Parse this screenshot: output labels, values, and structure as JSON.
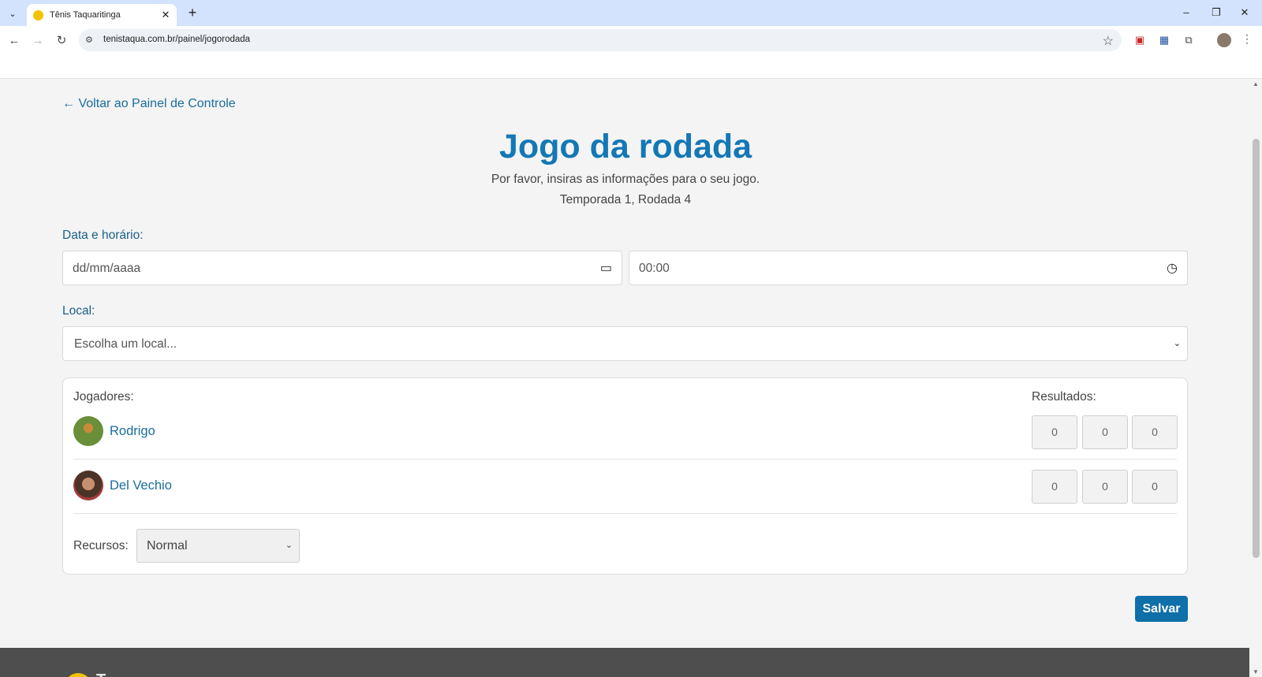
{
  "browser": {
    "tab_title": "Tênis Taquaritinga",
    "url": "tenistaqua.com.br/painel/jogorodada"
  },
  "page": {
    "back_link": "← Voltar ao Painel de Controle",
    "title": "Jogo da rodada",
    "subtitle": "Por favor, insiras as informações para o seu jogo.",
    "round": "Temporada 1, Rodada 4"
  },
  "form": {
    "datetime_label": "Data e horário:",
    "date_placeholder": "dd/mm/aaaa",
    "time_value": "00:00",
    "local_label": "Local:",
    "local_placeholder": "Escolha um local...",
    "players_label": "Jogadores:",
    "results_label": "Resultados:",
    "players": [
      {
        "name": "Rodrigo",
        "scores": [
          "0",
          "0",
          "0"
        ]
      },
      {
        "name": "Del Vechio",
        "scores": [
          "0",
          "0",
          "0"
        ]
      }
    ],
    "resources_label": "Recursos:",
    "resources_value": "Normal",
    "save_label": "Salvar"
  },
  "footer": {
    "brand_partial": "T"
  },
  "colors": {
    "accent": "#1378b5",
    "link": "#1a6d9b",
    "button": "#0f6fa8"
  }
}
